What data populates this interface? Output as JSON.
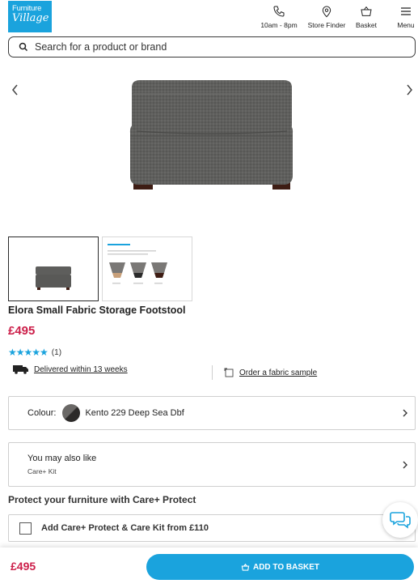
{
  "header": {
    "logo_line1": "Furniture",
    "logo_line2": "Village",
    "nav": {
      "hours": "10am - 8pm",
      "store": "Store Finder",
      "basket": "Basket",
      "menu": "Menu"
    }
  },
  "search": {
    "placeholder": "Search for a product or brand"
  },
  "product": {
    "title": "Elora Small Fabric Storage Footstool",
    "price": "£495",
    "rating_stars": "★★★★★",
    "rating_value": 5,
    "review_count": "(1)",
    "delivery": "Delivered within 13 weeks",
    "fabric_sample": "Order a fabric sample"
  },
  "colour": {
    "label": "Colour:",
    "value": "Kento 229 Deep Sea Dbf"
  },
  "also_like": {
    "title": "You may also like",
    "item": "Care+ Kit"
  },
  "protect": {
    "title": "Protect your furniture with Care+ Protect",
    "option_label": "Add Care+ Protect & Care Kit from £110"
  },
  "bottom": {
    "price": "£495",
    "add_label": "ADD TO BASKET"
  },
  "colors": {
    "brand": "#1aa3dd",
    "price": "#cc1f4a"
  }
}
